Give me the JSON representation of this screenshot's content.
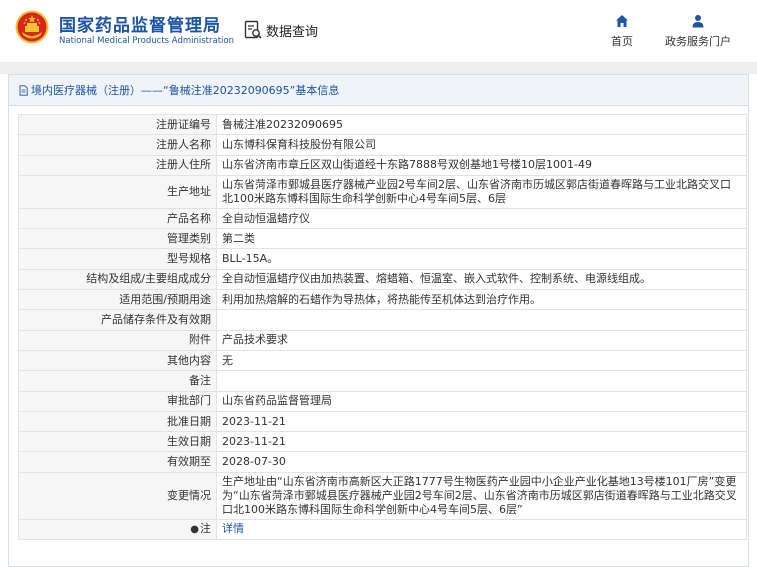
{
  "header": {
    "title_cn": "国家药品监督管理局",
    "title_en": "National Medical Products Administration",
    "section_label": "数据查询",
    "nav": [
      {
        "label": "首页",
        "icon": "home-icon"
      },
      {
        "label": "政务服务门户",
        "icon": "user-icon"
      }
    ],
    "colors": {
      "brand": "#1d55a6",
      "emblem_red": "#d9261c",
      "emblem_gold": "#f2c230"
    }
  },
  "breadcrumb": {
    "text": "境内医疗器械（注册）——“鲁械注准20232090695”基本信息",
    "icon": "document-icon"
  },
  "details": [
    {
      "label": "注册证编号",
      "value": "鲁械注准20232090695"
    },
    {
      "label": "注册人名称",
      "value": "山东博科保育科技股份有限公司"
    },
    {
      "label": "注册人住所",
      "value": "山东省济南市章丘区双山街道经十东路7888号双创基地1号楼10层1001-49"
    },
    {
      "label": "生产地址",
      "value": "山东省菏泽市鄄城县医疗器械产业园2号车间2层、山东省济南市历城区郭店街道春晖路与工业北路交叉口北100米路东博科国际生命科学创新中心4号车间5层、6层"
    },
    {
      "label": "产品名称",
      "value": "全自动恒温蜡疗仪"
    },
    {
      "label": "管理类别",
      "value": "第二类"
    },
    {
      "label": "型号规格",
      "value": "BLL-15A。"
    },
    {
      "label": "结构及组成/主要组成成分",
      "value": "全自动恒温蜡疗仪由加热装置、熔蜡箱、恒温室、嵌入式软件、控制系统、电源线组成。"
    },
    {
      "label": "适用范围/预期用途",
      "value": "利用加热熔解的石蜡作为导热体，将热能传至机体达到治疗作用。"
    },
    {
      "label": "产品储存条件及有效期",
      "value": ""
    },
    {
      "label": "附件",
      "value": "产品技术要求"
    },
    {
      "label": "其他内容",
      "value": "无"
    },
    {
      "label": "备注",
      "value": ""
    },
    {
      "label": "审批部门",
      "value": "山东省药品监督管理局"
    },
    {
      "label": "批准日期",
      "value": "2023-11-21"
    },
    {
      "label": "生效日期",
      "value": "2023-11-21"
    },
    {
      "label": "有效期至",
      "value": "2028-07-30"
    },
    {
      "label": "变更情况",
      "value": "生产地址由“山东省济南市高新区大正路1777号生物医药产业园中小企业产业化基地13号楼101厂房”变更为“山东省菏泽市鄄城县医疗器械产业园2号车间2层、山东省济南市历城区郭店街道春晖路与工业北路交叉口北100米路东博科国际生命科学创新中心4号车间5层、6层”"
    }
  ],
  "note": {
    "label": "注",
    "link": "详情",
    "icon": "pin-icon"
  }
}
